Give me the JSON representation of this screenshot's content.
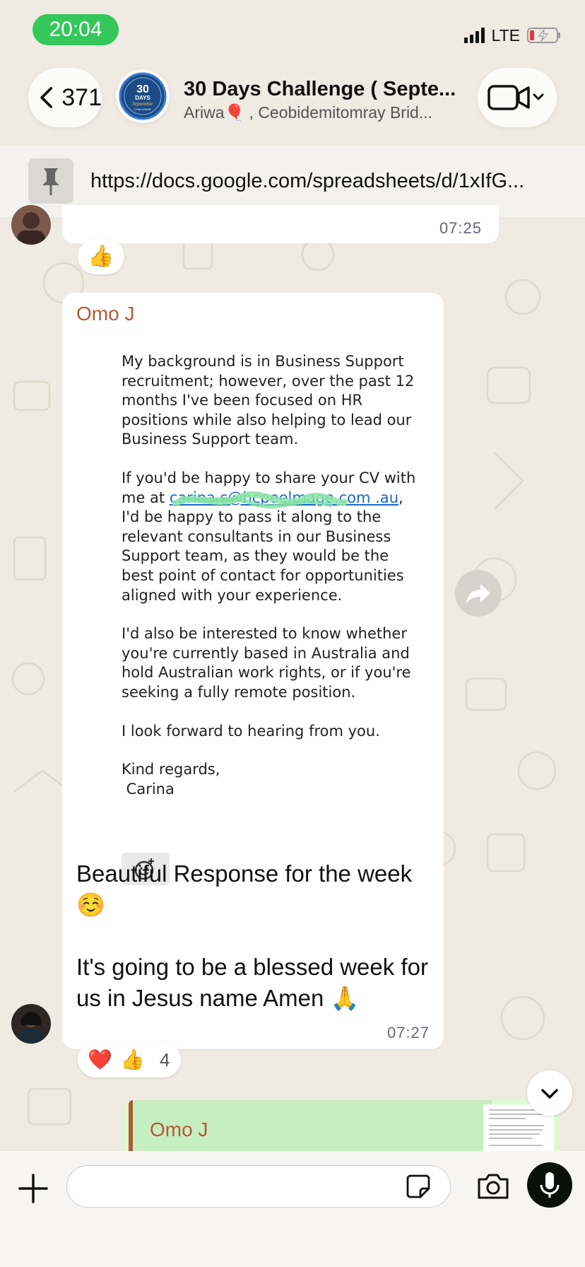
{
  "status_bar": {
    "time": "20:04",
    "network": "LTE"
  },
  "header": {
    "back_count": "371",
    "title": "30 Days Challenge ( Septe...",
    "subtitle": "Ariwa🎈 , Ceobidemitomray Brid...",
    "avatar_text_1": "30",
    "avatar_text_2": "DAYS",
    "avatar_text_3": "September",
    "avatar_text_4": "CHALLENGE"
  },
  "pinned": {
    "url": "https://docs.google.com/spreadsheets/d/1xIfG..."
  },
  "messages": {
    "previous": {
      "time": "07:25",
      "reaction": "👍"
    },
    "current": {
      "sender": "Omo J",
      "screenshot": {
        "p1": "My background is in Business Support recruitment; however, over the past 12 months I've been focused on HR positions while also helping to lead our Business Support team.",
        "p2_a": "If you'd be happy to share your CV with me at ",
        "p2_link": "carina.s@hcpeelmage.com .au",
        "p2_b": ", I'd be happy to pass it along to the relevant consultants in our Business Support team, as they would be the best point of contact for opportunities aligned with your experience.",
        "p3": "I'd also be interested to know whether you're currently based in Australia and hold Australian work rights, or if you're seeking a fully remote position.",
        "p4": "I look forward to hearing from you.",
        "p5_line1": "Kind regards,",
        "p5_line2": " Carina"
      },
      "caption_1": "Beautiful Response for the week ☺️",
      "caption_2": "It's going to be a blessed week for us in Jesus name Amen 🙏",
      "time": "07:27",
      "reactions": {
        "heart": "❤️",
        "thumbs": "👍",
        "count": "4"
      }
    },
    "reply_preview": {
      "sender": "Omo J"
    }
  },
  "icons": [
    "chevron-left-icon",
    "video-camera-icon",
    "chevron-down-icon",
    "pin-icon",
    "forward-icon",
    "add-emoji-icon",
    "plus-icon",
    "sticker-icon",
    "camera-icon",
    "microphone-icon",
    "signal-icon",
    "battery-icon"
  ],
  "colors": {
    "status_green": "#34c759",
    "sender_color": "#b35a35",
    "chat_bg": "#efeae2",
    "link": "#1a66c9"
  }
}
